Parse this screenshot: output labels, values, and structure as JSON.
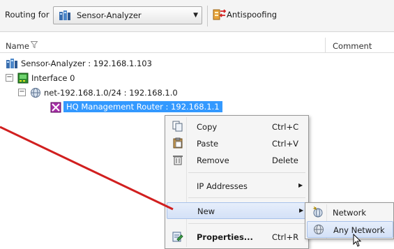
{
  "toolbar": {
    "routing_label": "Routing for",
    "routing_value": "Sensor-Analyzer",
    "antispoofing_label": "Antispoofing"
  },
  "columns": {
    "name": "Name",
    "comment": "Comment"
  },
  "tree": {
    "root": "Sensor-Analyzer : 192.168.1.103",
    "interface": "Interface 0",
    "network": "net-192.168.1.0/24 : 192.168.1.0",
    "router": "HQ Management Router : 192.168.1.1"
  },
  "context_menu": {
    "copy": {
      "label": "Copy",
      "shortcut": "Ctrl+C"
    },
    "paste": {
      "label": "Paste",
      "shortcut": "Ctrl+V"
    },
    "remove": {
      "label": "Remove",
      "shortcut": "Delete"
    },
    "ip_addresses": {
      "label": "IP Addresses"
    },
    "new": {
      "label": "New"
    },
    "properties": {
      "label": "Properties...",
      "shortcut": "Ctrl+R"
    }
  },
  "submenu": {
    "network": "Network",
    "any_network": "Any Network"
  },
  "colors": {
    "selection": "#3399ff",
    "annotation_arrow": "#d11f1f",
    "menu_highlight": "#d4e1f7"
  },
  "icons": {
    "routing_target": "firewall-engine-icon",
    "antispoofing": "antispoofing-icon",
    "interface": "interface-icon",
    "network": "network-icon",
    "router": "router-icon"
  }
}
